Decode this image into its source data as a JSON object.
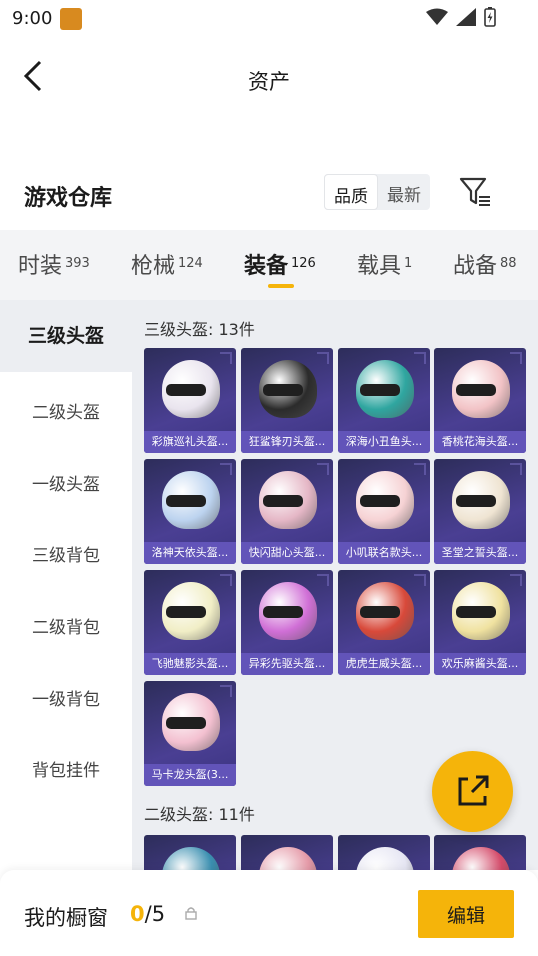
{
  "status": {
    "time": "9:00"
  },
  "header": {
    "title": "资产"
  },
  "section": {
    "title": "游戏仓库",
    "sort_options": [
      "品质",
      "最新"
    ]
  },
  "tabs": [
    {
      "label": "时装",
      "count": "393"
    },
    {
      "label": "枪械",
      "count": "124"
    },
    {
      "label": "装备",
      "count": "126"
    },
    {
      "label": "载具",
      "count": "1"
    },
    {
      "label": "战备",
      "count": "88"
    }
  ],
  "sidebar": {
    "items": [
      "三级头盔",
      "二级头盔",
      "一级头盔",
      "三级背包",
      "二级背包",
      "一级背包",
      "背包挂件"
    ]
  },
  "groups": [
    {
      "title": "三级头盔: 13件"
    },
    {
      "title": "二级头盔: 11件"
    }
  ],
  "items": [
    {
      "label": "彩旗巡礼头盔...",
      "color": "#e9e4ee"
    },
    {
      "label": "狂鲨锋刃头盔...",
      "color": "#2b2b2b"
    },
    {
      "label": "深海小丑鱼头...",
      "color": "#2fa6a0"
    },
    {
      "label": "香桃花海头盔...",
      "color": "#f2c3c6"
    },
    {
      "label": "洛神天依头盔...",
      "color": "#bcd3ef"
    },
    {
      "label": "快闪甜心头盔...",
      "color": "#e5b7c6"
    },
    {
      "label": "小叽联名款头...",
      "color": "#f6d2d4"
    },
    {
      "label": "圣堂之誓头盔...",
      "color": "#efe4d2"
    },
    {
      "label": "飞驰魅影头盔...",
      "color": "#f1eec6"
    },
    {
      "label": "异彩先驱头盔...",
      "color": "#d06fd6"
    },
    {
      "label": "虎虎生威头盔...",
      "color": "#d8493a"
    },
    {
      "label": "欢乐麻酱头盔...",
      "color": "#f0e2a0"
    },
    {
      "label": "马卡龙头盔(3...",
      "color": "#f3c0d0"
    }
  ],
  "items_partial": [
    {
      "color": "#3a8fb0"
    },
    {
      "color": "#e59aa8"
    },
    {
      "color": "#e6e6f3"
    },
    {
      "color": "#d44b6a"
    }
  ],
  "showcase": {
    "title": "我的橱窗",
    "current": "0",
    "total": "/5",
    "edit_label": "编辑"
  },
  "colors": {
    "accent": "#f5b40a",
    "card_label": "#6254b9",
    "card_bg": "#3b3380"
  }
}
